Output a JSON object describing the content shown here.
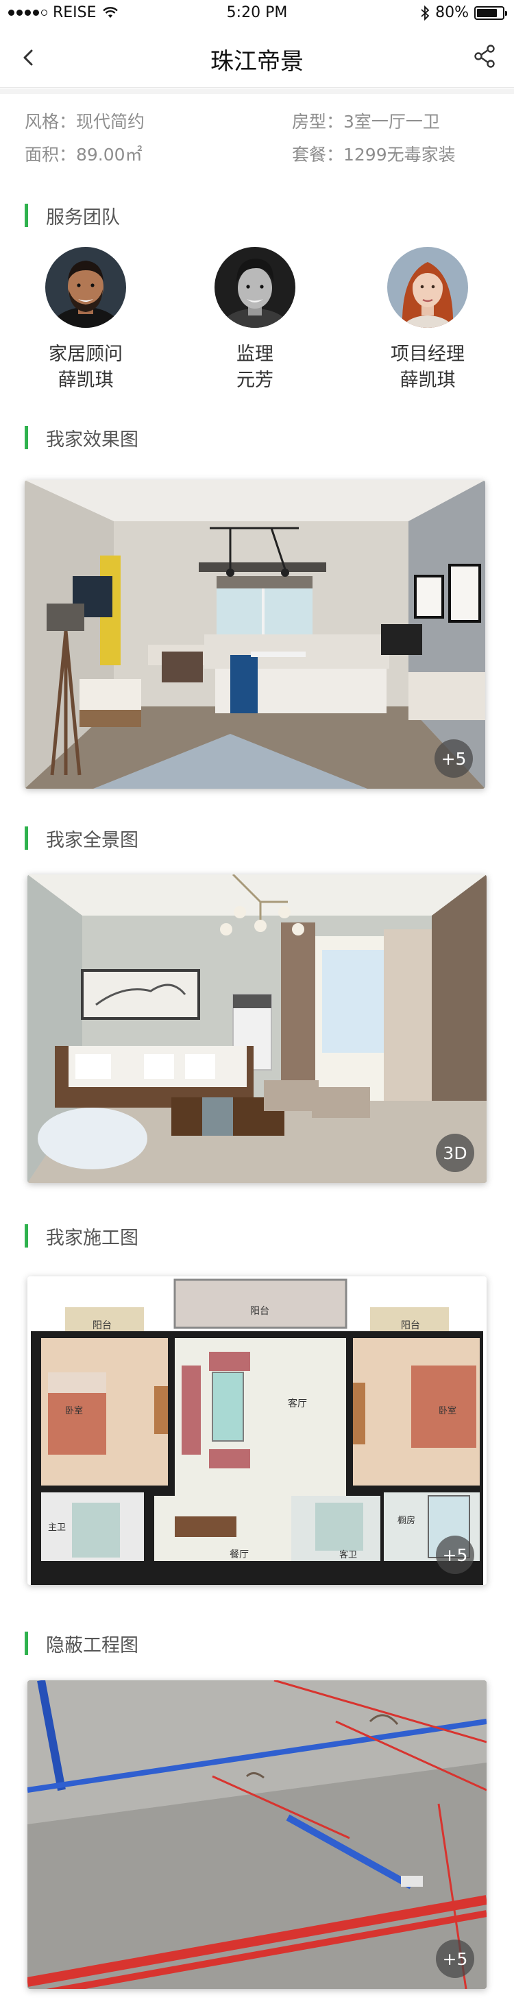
{
  "status_bar": {
    "carrier": "REISE",
    "time": "5:20 PM",
    "battery": "80%",
    "battery_level": 0.8
  },
  "nav": {
    "title": "珠江帝景"
  },
  "info": {
    "style": "风格：现代简约",
    "layout": "房型：3室一厅一卫",
    "area": "面积：89.00㎡",
    "package": "套餐：1299无毒家装"
  },
  "team": {
    "title": "服务团队",
    "members": [
      {
        "role": "家居顾问",
        "name": "薛凯琪"
      },
      {
        "role": "监理",
        "name": "元芳"
      },
      {
        "role": "项目经理",
        "name": "薛凯琪"
      }
    ]
  },
  "renderings": {
    "title": "我家效果图",
    "badge": "+5"
  },
  "panorama": {
    "title": "我家全景图",
    "badge": "3D"
  },
  "construction": {
    "title": "我家施工图",
    "badge": "+5",
    "labels": {
      "balcony_left": "阳台",
      "balcony_center": "阳台",
      "balcony_right": "阳台",
      "bedroom_left": "卧室",
      "bedroom_right": "卧室",
      "living_room": "客厅",
      "dining": "餐厅",
      "master_bath": "主卫",
      "guest_bath": "客卫",
      "kitchen": "橱房"
    }
  },
  "hidden_works": {
    "title": "隐蔽工程图",
    "badge": "+5"
  }
}
